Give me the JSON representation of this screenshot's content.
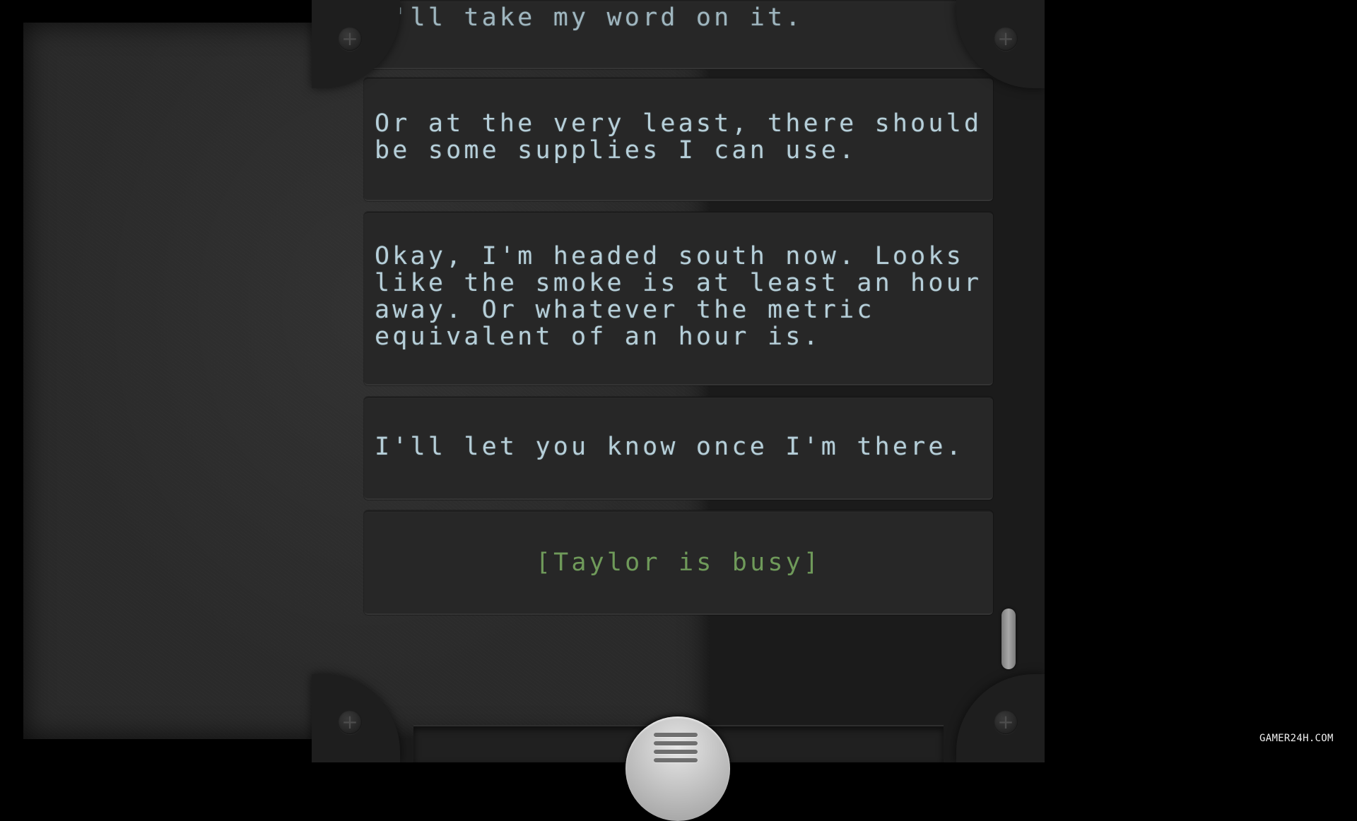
{
  "messages": [
    {
      "text": "Or at the very least, there should be some supplies I can use."
    },
    {
      "text": "Okay, I'm headed south now. Looks like the smoke is at least an hour away. Or whatever the metric equivalent of an hour is."
    },
    {
      "text": "I'll let you know once I'm there."
    }
  ],
  "partial_message": "I'll take my word on it.",
  "status": "[Taylor is busy]",
  "watermark": "GAMER24H.COM",
  "icons": {
    "screw": "plus",
    "menu": "hamburger-icon"
  },
  "colors": {
    "message_text": "#b6cfd9",
    "status_text": "#6f9a5a",
    "background": "#2a2a2a"
  }
}
